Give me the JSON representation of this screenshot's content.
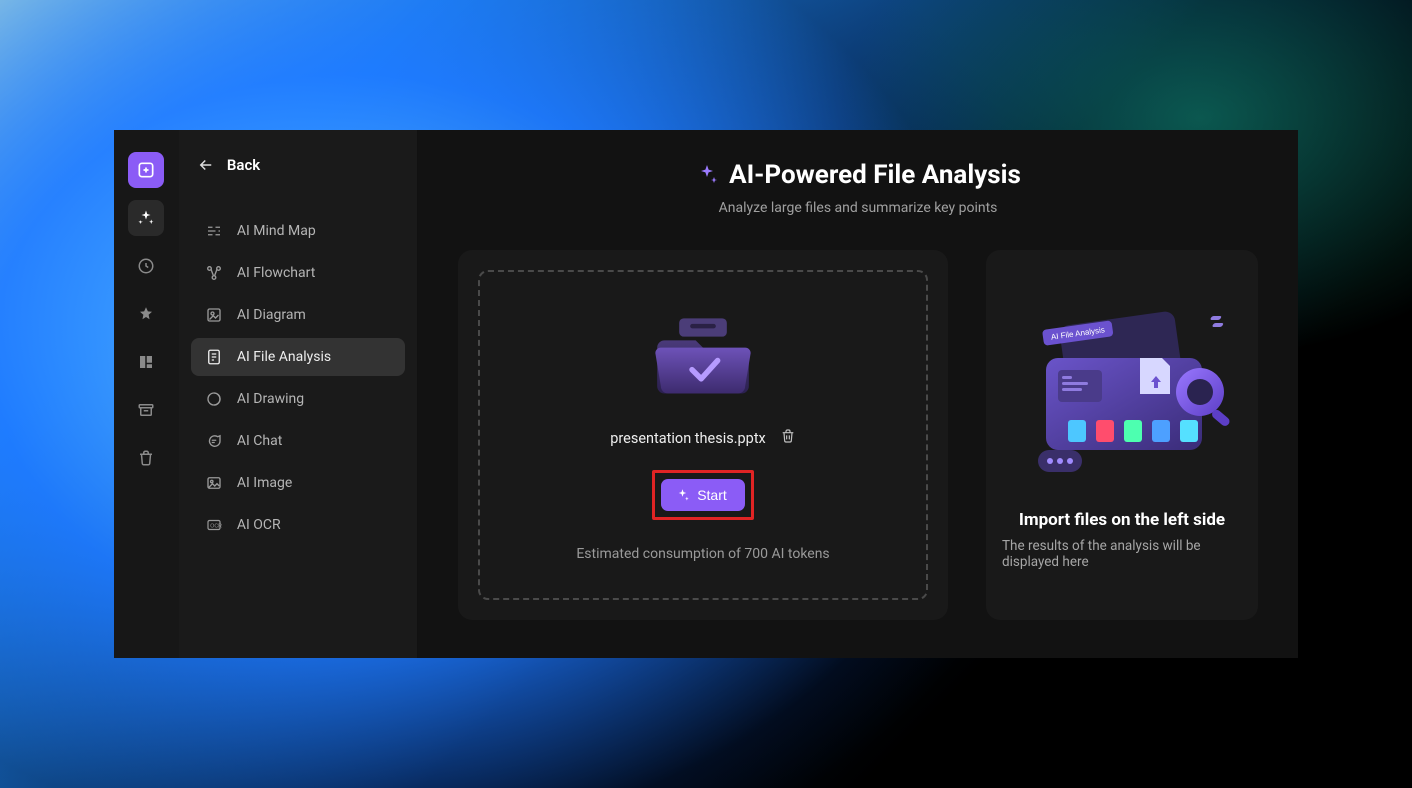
{
  "rail": {
    "items": [
      {
        "name": "new-icon"
      },
      {
        "name": "sparkle-icon"
      },
      {
        "name": "clock-icon"
      },
      {
        "name": "star-icon"
      },
      {
        "name": "templates-icon"
      },
      {
        "name": "archive-icon"
      },
      {
        "name": "trash-icon"
      }
    ]
  },
  "sidebar": {
    "back_label": "Back",
    "items": [
      {
        "label": "AI Mind Map"
      },
      {
        "label": "AI Flowchart"
      },
      {
        "label": "AI Diagram"
      },
      {
        "label": "AI File Analysis"
      },
      {
        "label": "AI Drawing"
      },
      {
        "label": "AI Chat"
      },
      {
        "label": "AI Image"
      },
      {
        "label": "AI OCR"
      }
    ],
    "selected_index": 3
  },
  "header": {
    "title": "AI-Powered File Analysis",
    "subtitle": "Analyze large files and summarize key points"
  },
  "upload": {
    "file_name": "presentation thesis.pptx",
    "start_label": "Start",
    "tokens_text": "Estimated consumption of 700 AI tokens"
  },
  "results": {
    "illustration_badge": "AI File Analysis",
    "title": "Import files on the left side",
    "subtitle": "The results of the analysis will be displayed here"
  },
  "colors": {
    "accent": "#8b5cf6",
    "highlight_box": "#e02424"
  }
}
